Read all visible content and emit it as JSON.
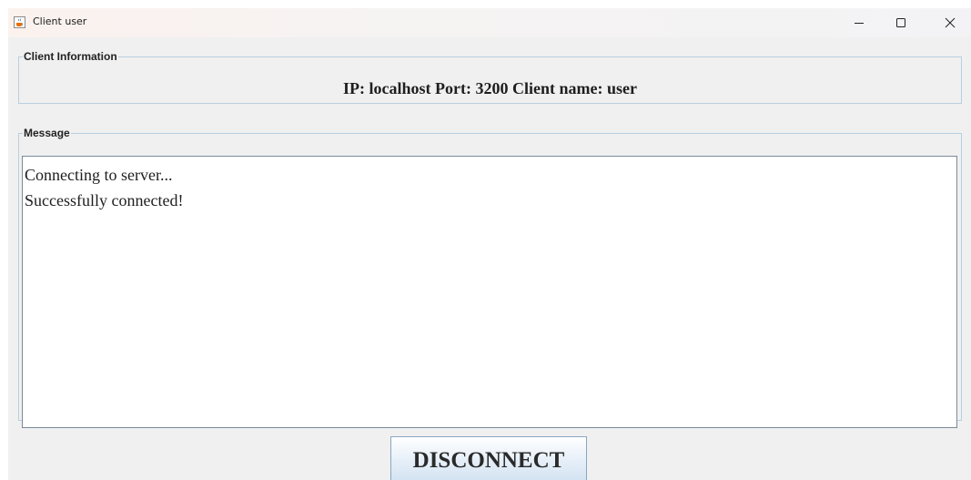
{
  "window": {
    "title": "Client user"
  },
  "client_info": {
    "legend": "Client Information",
    "text": "IP: localhost Port: 3200 Client name: user"
  },
  "message": {
    "legend": "Message",
    "lines": [
      "Connecting to server...",
      "Successfully connected!"
    ]
  },
  "actions": {
    "disconnect_label": "DISCONNECT"
  },
  "icons": {
    "app": "java-coffee-icon",
    "minimize": "minimize-icon",
    "maximize": "maximize-icon",
    "close": "close-icon"
  },
  "colors": {
    "window_bg": "#f0f0f0",
    "border": "#b8cfe0",
    "button_gradient_bottom": "#d2e2f1"
  }
}
